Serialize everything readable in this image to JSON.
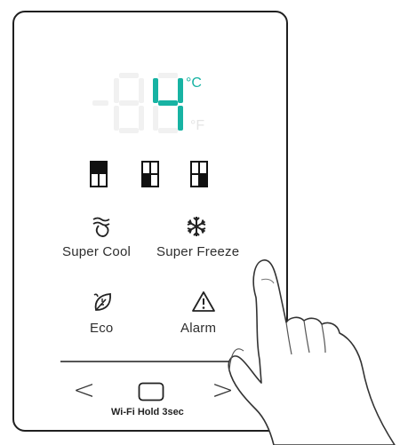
{
  "display": {
    "temperature": "-84",
    "unit_c": "°C",
    "unit_f": "°F",
    "active_unit": "C",
    "accent_color": "#17b3a3",
    "dim_color": "#f1f1f1"
  },
  "compartment_indicators": [
    {
      "icon": "compartment-top-icon",
      "selected": "top"
    },
    {
      "icon": "compartment-bottom-left-icon",
      "selected": "bottom-left"
    },
    {
      "icon": "compartment-bottom-right-icon",
      "selected": "bottom-right"
    }
  ],
  "buttons": {
    "super_cool": {
      "label": "Super Cool",
      "icon": "super-cool-icon"
    },
    "super_freeze": {
      "label": "Super Freeze",
      "icon": "snowflake-icon"
    },
    "eco": {
      "label": "Eco",
      "icon": "leaf-icon"
    },
    "alarm": {
      "label": "Alarm",
      "icon": "warning-icon"
    }
  },
  "navigation": {
    "prev": "<",
    "next": ">",
    "wifi_label": "Wi-Fi Hold 3sec"
  }
}
